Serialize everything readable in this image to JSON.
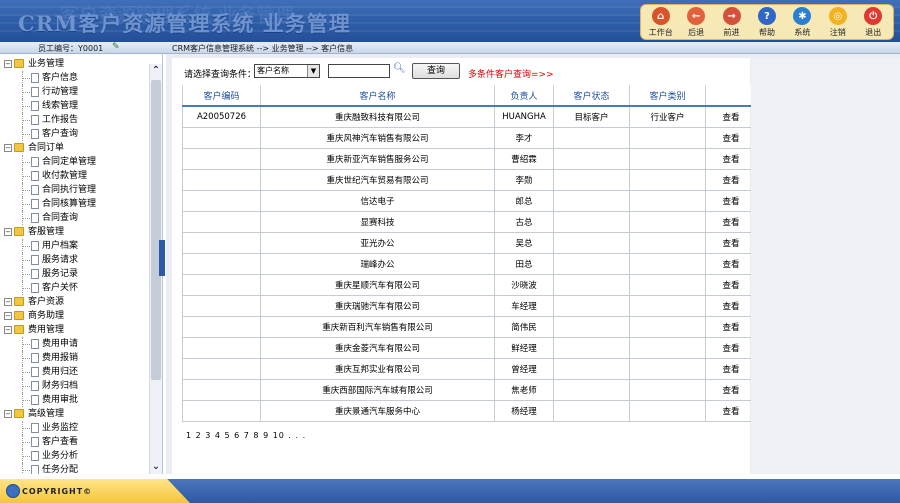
{
  "app": {
    "title": "CRM客户资源管理系统 业务管理",
    "title_ghost": "客户资源管理系统 业务管理"
  },
  "toolbar": [
    {
      "label": "工作台",
      "icon": "home-icon",
      "glyph": "⌂",
      "color": "#d9532c"
    },
    {
      "label": "后退",
      "icon": "back-icon",
      "glyph": "←",
      "color": "#e2603c"
    },
    {
      "label": "前进",
      "icon": "forward-icon",
      "glyph": "→",
      "color": "#d4503a"
    },
    {
      "label": "帮助",
      "icon": "help-icon",
      "glyph": "?",
      "color": "#2f67c8"
    },
    {
      "label": "系统",
      "icon": "system-gear-icon",
      "glyph": "✱",
      "color": "#2a7fd0"
    },
    {
      "label": "注销",
      "icon": "logout-icon",
      "glyph": "◎",
      "color": "#f3b321"
    },
    {
      "label": "退出",
      "icon": "exit-power-icon",
      "glyph": "⏻",
      "color": "#e0392f"
    }
  ],
  "user": {
    "label": "员工编号：Y0001"
  },
  "breadcrumb": "CRM客户信息管理系统 --> 业务管理 --> 客户信息",
  "sidebar": {
    "rows": [
      {
        "type": "category",
        "label": "业务管理"
      },
      {
        "type": "item",
        "label": "客户信息"
      },
      {
        "type": "item",
        "label": "行动管理"
      },
      {
        "type": "item",
        "label": "线索管理"
      },
      {
        "type": "item",
        "label": "工作报告"
      },
      {
        "type": "item",
        "label": "客户查询"
      },
      {
        "type": "category",
        "label": "合同订单"
      },
      {
        "type": "item",
        "label": "合同定单管理"
      },
      {
        "type": "item",
        "label": "收付款管理"
      },
      {
        "type": "item",
        "label": "合同执行管理"
      },
      {
        "type": "item",
        "label": "合同核算管理"
      },
      {
        "type": "item",
        "label": "合同查询"
      },
      {
        "type": "category",
        "label": "客服管理"
      },
      {
        "type": "item",
        "label": "用户档案"
      },
      {
        "type": "item",
        "label": "服务请求"
      },
      {
        "type": "item",
        "label": "服务记录"
      },
      {
        "type": "item",
        "label": "客户关怀"
      },
      {
        "type": "category",
        "label": "客户资源"
      },
      {
        "type": "category",
        "label": "商务助理"
      },
      {
        "type": "category",
        "label": "费用管理"
      },
      {
        "type": "item",
        "label": "费用申请"
      },
      {
        "type": "item",
        "label": "费用报销"
      },
      {
        "type": "item",
        "label": "费用归还"
      },
      {
        "type": "item",
        "label": "财务归档"
      },
      {
        "type": "item",
        "label": "费用审批"
      },
      {
        "type": "category",
        "label": "高级管理"
      },
      {
        "type": "item",
        "label": "业务监控"
      },
      {
        "type": "item",
        "label": "客户查看"
      },
      {
        "type": "item",
        "label": "业务分析"
      },
      {
        "type": "item",
        "label": "任务分配"
      }
    ]
  },
  "search": {
    "label": "请选择查询条件：",
    "select_value": "客户名称",
    "input_value": "",
    "button_label": "查询",
    "multi_link": "多条件客户查询=>>"
  },
  "table": {
    "headers": [
      "客户编码",
      "客户名称",
      "负责人",
      "客户状态",
      "客户类别",
      ""
    ],
    "rows": [
      [
        "A20050726",
        "重庆融致科技有限公司",
        "HUANGHA",
        "目标客户",
        "行业客户",
        "查看"
      ],
      [
        "",
        "重庆风神汽车销售有限公司",
        "李才",
        "",
        "",
        "查看"
      ],
      [
        "",
        "重庆新亚汽车销售服务公司",
        "曹绍霖",
        "",
        "",
        "查看"
      ],
      [
        "",
        "重庆世纪汽车贸易有限公司",
        "李勋",
        "",
        "",
        "查看"
      ],
      [
        "",
        "信达电子",
        "郎总",
        "",
        "",
        "查看"
      ],
      [
        "",
        "显赛科技",
        "古总",
        "",
        "",
        "查看"
      ],
      [
        "",
        "亚光办公",
        "吴总",
        "",
        "",
        "查看"
      ],
      [
        "",
        "瑞峰办公",
        "田总",
        "",
        "",
        "查看"
      ],
      [
        "",
        "重庆星顺汽车有限公司",
        "沙晓波",
        "",
        "",
        "查看"
      ],
      [
        "",
        "重庆瑞驰汽车有限公司",
        "车经理",
        "",
        "",
        "查看"
      ],
      [
        "",
        "重庆新百利汽车销售有限公司",
        "简伟民",
        "",
        "",
        "查看"
      ],
      [
        "",
        "重庆金菱汽车有限公司",
        "鲜经理",
        "",
        "",
        "查看"
      ],
      [
        "",
        "重庆互邦实业有限公司",
        "曾经理",
        "",
        "",
        "查看"
      ],
      [
        "",
        "重庆西部国际汽车城有限公司",
        "焦老师",
        "",
        "",
        "查看"
      ],
      [
        "",
        "重庆景通汽车服务中心",
        "杨经理",
        "",
        "",
        "查看"
      ]
    ]
  },
  "pager": "1 2 3 4 5 6 7 8 9 10 . . .",
  "footer": {
    "copyright": "COPYRIGHT©"
  }
}
